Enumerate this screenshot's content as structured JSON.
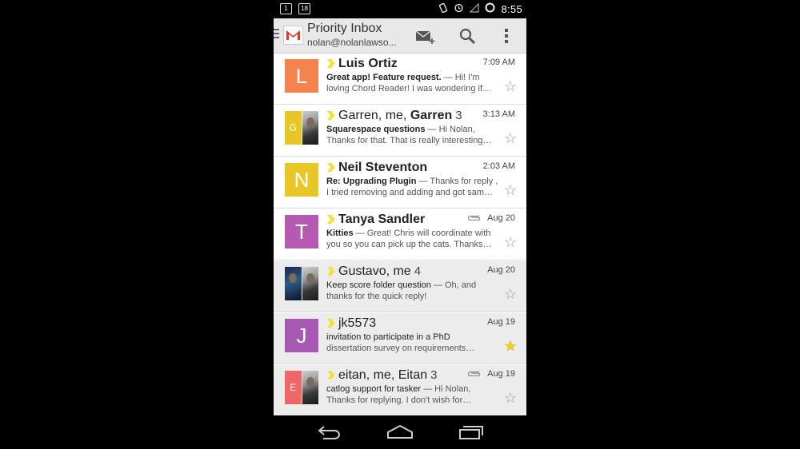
{
  "statusbar": {
    "time": "8:55",
    "notif_badge": "1",
    "notif_badge2": "18"
  },
  "actionbar": {
    "title": "Priority Inbox",
    "account": "nolan@nolanlawso..."
  },
  "colors": {
    "orange": "#f4834e",
    "yellow": "#e8c626",
    "purple": "#b45bb1",
    "violet": "#a659b0",
    "red": "#f06565",
    "marker": "#f4e03c"
  },
  "messages": [
    {
      "sender": "Luis Ortiz",
      "count": "",
      "date": "7:09 AM",
      "subject": "Great app! Feature request.",
      "preview1": " — Hi! I'm",
      "preview2": "loving Chord Reader! I was wondering if…",
      "starred": false,
      "initial": "L"
    },
    {
      "sender": "Garren, me, ",
      "sender_bold": "Garren",
      "count": "3",
      "date": "3:13 AM",
      "subject": "Squarespace questions",
      "preview1": " — Hi Nolan,",
      "preview2": "Thanks for that. That is really interesting…",
      "starred": false,
      "initial": "G"
    },
    {
      "sender": "Neil Steventon",
      "count": "",
      "date": "2:03 AM",
      "subject": "Re: Upgrading Plugin",
      "preview1": " — Thanks for reply ,",
      "preview2": "I tried removing and adding and got sam…",
      "starred": false,
      "initial": "N"
    },
    {
      "sender": "Tanya Sandler",
      "count": "",
      "date": "Aug 20",
      "subject": "Kitties",
      "preview1": " — Great! Chris will coordinate with",
      "preview2": "you so you can pick up the cats. Thanks…",
      "starred": false,
      "initial": "T"
    },
    {
      "sender": "Gustavo, me",
      "count": "4",
      "date": "Aug 20",
      "subject": "Keep score folder question",
      "preview1": " — Oh, and",
      "preview2": "thanks for the quick reply!",
      "starred": false,
      "initial": ""
    },
    {
      "sender": "jk5573",
      "count": "",
      "date": "Aug 19",
      "subject": "invitation to participate in a PhD",
      "preview1": "",
      "preview2": "dissertation survey on requirements…",
      "starred": true,
      "initial": "J"
    },
    {
      "sender": "eitan, me, Eitan",
      "count": "3",
      "date": "Aug 19",
      "subject": "catlog support for tasker",
      "preview1": " — Hi Nolan,",
      "preview2": "Thanks for replying. I don't wish for…",
      "starred": false,
      "initial": "E"
    }
  ],
  "icons": {
    "compose": "compose-icon",
    "search": "search-icon",
    "overflow": "overflow-menu-icon",
    "back": "back-icon",
    "home": "home-icon",
    "recents": "recents-icon",
    "star": "star-icon",
    "attachment": "paperclip-icon",
    "importance": "importance-marker-icon"
  }
}
